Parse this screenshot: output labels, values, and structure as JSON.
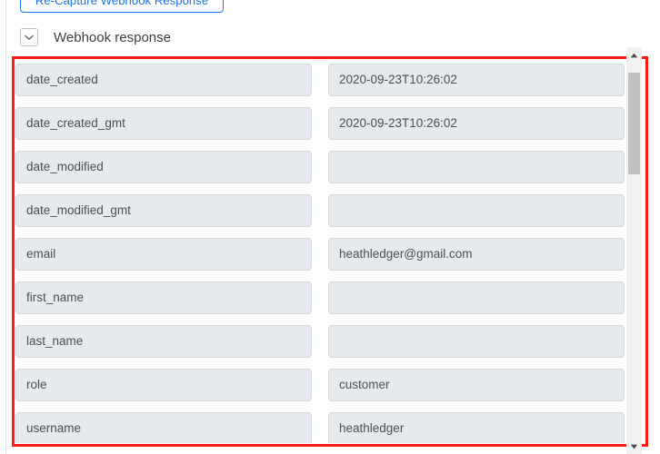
{
  "toolbar": {
    "recapture_label": "Re-Capture Webhook Response"
  },
  "section": {
    "title": "Webhook response",
    "toggle_icon": "chevron-down-icon",
    "expanded": true
  },
  "highlight": {
    "color": "#ff1a13"
  },
  "theme": {
    "accent": "#1a73e8",
    "field_bg": "#e6eaee",
    "field_border": "#d2d9df",
    "text": "#4a4f55"
  },
  "scrollbar": {
    "up_arrow_icon": "triangle-up-icon",
    "down_arrow_icon": "triangle-down-icon",
    "thumb_top_pct": 6,
    "thumb_height_pct": 25
  },
  "fields": [
    {
      "key": "date_created",
      "value": "2020-09-23T10:26:02"
    },
    {
      "key": "date_created_gmt",
      "value": "2020-09-23T10:26:02"
    },
    {
      "key": "date_modified",
      "value": ""
    },
    {
      "key": "date_modified_gmt",
      "value": ""
    },
    {
      "key": "email",
      "value": "heathledger@gmail.com"
    },
    {
      "key": "first_name",
      "value": ""
    },
    {
      "key": "last_name",
      "value": ""
    },
    {
      "key": "role",
      "value": "customer"
    },
    {
      "key": "username",
      "value": "heathledger"
    }
  ]
}
